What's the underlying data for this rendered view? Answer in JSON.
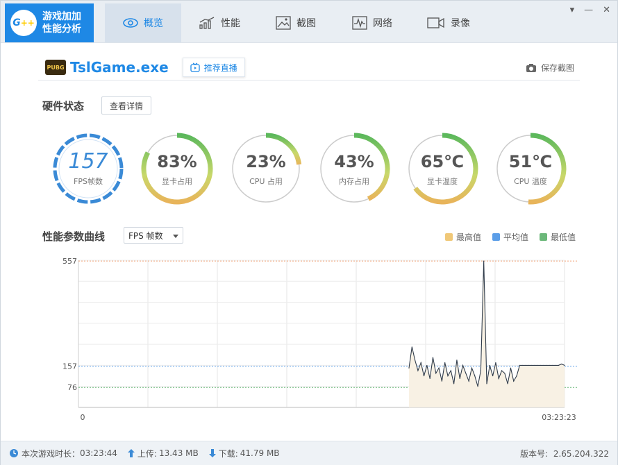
{
  "brand": {
    "line1": "游戏加加",
    "line2": "性能分析",
    "logo_text": "G",
    "logo_plus": "++"
  },
  "tabs": [
    {
      "label": "概览",
      "icon": "eye-icon",
      "active": true
    },
    {
      "label": "性能",
      "icon": "performance-chart-icon",
      "active": false
    },
    {
      "label": "截图",
      "icon": "screenshot-icon",
      "active": false
    },
    {
      "label": "网络",
      "icon": "network-pulse-icon",
      "active": false
    },
    {
      "label": "录像",
      "icon": "video-camera-icon",
      "active": false
    }
  ],
  "window_controls": {
    "menu": "▾",
    "minimize": "—",
    "close": "✕"
  },
  "game": {
    "badge": "PUBG",
    "title": "TslGame.exe",
    "recommend_label": "推荐直播"
  },
  "save_screenshot_label": "保存截图",
  "hardware": {
    "title": "硬件状态",
    "details_button": "查看详情"
  },
  "gauges": [
    {
      "value": "157",
      "label": "FPS帧数",
      "percent": 1.0,
      "type": "fps"
    },
    {
      "value": "83%",
      "label": "显卡占用",
      "percent": 0.83,
      "type": "ring"
    },
    {
      "value": "23%",
      "label": "CPU 占用",
      "percent": 0.23,
      "type": "ring"
    },
    {
      "value": "43%",
      "label": "内存占用",
      "percent": 0.43,
      "type": "ring"
    },
    {
      "value": "65℃",
      "label": "显卡温度",
      "percent": 0.65,
      "type": "ring"
    },
    {
      "value": "51℃",
      "label": "CPU 温度",
      "percent": 0.51,
      "type": "ring"
    }
  ],
  "curve": {
    "title": "性能参数曲线",
    "selector_value": "FPS 帧数",
    "legend": [
      {
        "label": "最高值",
        "color": "#f0c878"
      },
      {
        "label": "平均值",
        "color": "#5b9ee8"
      },
      {
        "label": "最低值",
        "color": "#6cb87a"
      }
    ]
  },
  "chart_data": {
    "type": "line",
    "y_ref_max": 557,
    "y_ref_avg": 157,
    "y_ref_min": 76,
    "ylim": [
      0,
      560
    ],
    "x_start_label": "0",
    "x_end_label": "03:23:23",
    "y_tick_labels": [
      "557",
      "157",
      "76"
    ],
    "data_start_fraction": 0.68,
    "series": [
      {
        "values": [
          150,
          230,
          180,
          140,
          170,
          120,
          160,
          110,
          190,
          130,
          150,
          100,
          170,
          120,
          140,
          90,
          180,
          110,
          160,
          130,
          100,
          150,
          120,
          80,
          140,
          557,
          90,
          160,
          120,
          170,
          110,
          140,
          130,
          90,
          150,
          100,
          120,
          160,
          160,
          160,
          160,
          160,
          160,
          160,
          160,
          160,
          160,
          160,
          160,
          160,
          160,
          165,
          160
        ]
      }
    ]
  },
  "status": {
    "play_time_label": "本次游戏时长：",
    "play_time": "03:23:44",
    "upload_label": "上传:",
    "upload": "13.43 MB",
    "download_label": "下载:",
    "download": "41.79 MB",
    "version_label": "版本号:",
    "version": "2.65.204.322"
  }
}
